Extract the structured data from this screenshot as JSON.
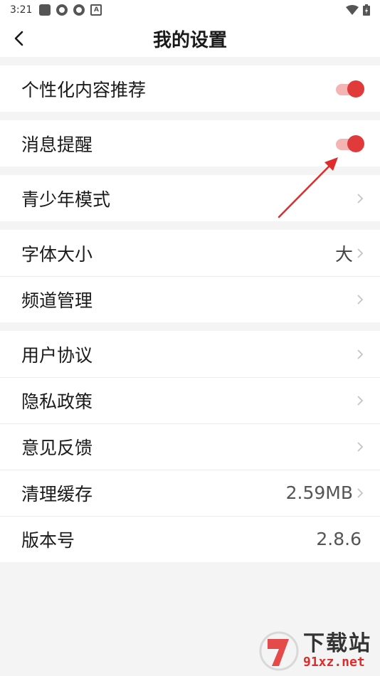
{
  "status_bar": {
    "time": "3:21"
  },
  "header": {
    "title": "我的设置"
  },
  "groups": [
    {
      "items": [
        {
          "label": "个性化内容推荐",
          "toggle": true
        }
      ]
    },
    {
      "items": [
        {
          "label": "消息提醒",
          "toggle": true
        }
      ]
    },
    {
      "items": [
        {
          "label": "青少年模式"
        }
      ]
    },
    {
      "items": [
        {
          "label": "字体大小",
          "value": "大"
        },
        {
          "label": "频道管理"
        }
      ]
    },
    {
      "items": [
        {
          "label": "用户协议"
        },
        {
          "label": "隐私政策"
        },
        {
          "label": "意见反馈"
        },
        {
          "label": "清理缓存",
          "value": "2.59MB"
        },
        {
          "label": "版本号",
          "value": "2.8.6"
        }
      ]
    }
  ],
  "colors": {
    "accent": "#e03a3a",
    "toggle_track": "#f4b4b4",
    "background": "#f4f4f4"
  },
  "watermark": {
    "main": "下载站",
    "sub": "91xz.net"
  }
}
